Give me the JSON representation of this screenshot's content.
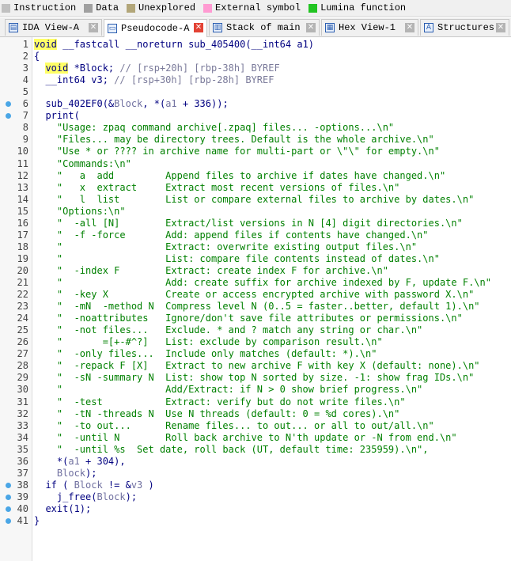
{
  "legend": [
    {
      "label": "Instruction",
      "color": "#c0c0c0"
    },
    {
      "label": "Data",
      "color": "#a0a0a0"
    },
    {
      "label": "Unexplored",
      "color": "#b2a679"
    },
    {
      "label": "External symbol",
      "color": "#ff9bd2"
    },
    {
      "label": "Lumina function",
      "color": "#22c422"
    }
  ],
  "tabs": [
    {
      "label": "IDA View-A",
      "icon": "ida-view-icon"
    },
    {
      "label": "Pseudocode-A",
      "icon": "pseudocode-icon"
    },
    {
      "label": "Stack of main",
      "icon": "stack-icon"
    },
    {
      "label": "Hex View-1",
      "icon": "hex-view-icon"
    },
    {
      "label": "Structures",
      "icon": "structures-icon"
    }
  ],
  "lines": [
    {
      "n": "1",
      "bp": false,
      "segs": [
        [
          "kw",
          "void"
        ],
        [
          "p",
          " __fastcall __noreturn sub_405400(__int64 a1)"
        ]
      ]
    },
    {
      "n": "2",
      "bp": false,
      "segs": [
        [
          "p",
          "{"
        ]
      ]
    },
    {
      "n": "3",
      "bp": false,
      "segs": [
        [
          "p",
          "  "
        ],
        [
          "kw",
          "void"
        ],
        [
          "p",
          " *Block; "
        ],
        [
          "cm",
          "// [rsp+20h] [rbp-38h] BYREF"
        ]
      ]
    },
    {
      "n": "4",
      "bp": false,
      "segs": [
        [
          "p",
          "  __int64 v3; "
        ],
        [
          "cm",
          "// [rsp+30h] [rbp-28h] BYREF"
        ]
      ]
    },
    {
      "n": "5",
      "bp": false,
      "segs": [
        [
          "p",
          ""
        ]
      ]
    },
    {
      "n": "6",
      "bp": true,
      "segs": [
        [
          "p",
          "  sub_402EF0(&"
        ],
        [
          "var",
          "Block"
        ],
        [
          "p",
          ", *("
        ],
        [
          "var",
          "a1"
        ],
        [
          "p",
          " + 336));"
        ]
      ]
    },
    {
      "n": "7",
      "bp": true,
      "segs": [
        [
          "p",
          "  print("
        ]
      ]
    },
    {
      "n": "8",
      "bp": false,
      "segs": [
        [
          "str",
          "    \"Usage: zpaq command archive[.zpaq] files... -options...\\n\""
        ]
      ]
    },
    {
      "n": "9",
      "bp": false,
      "segs": [
        [
          "str",
          "    \"Files... may be directory trees. Default is the whole archive.\\n\""
        ]
      ]
    },
    {
      "n": "10",
      "bp": false,
      "segs": [
        [
          "str",
          "    \"Use * or ???? in archive name for multi-part or \\\"\\\" for empty.\\n\""
        ]
      ]
    },
    {
      "n": "11",
      "bp": false,
      "segs": [
        [
          "str",
          "    \"Commands:\\n\""
        ]
      ]
    },
    {
      "n": "12",
      "bp": false,
      "segs": [
        [
          "str",
          "    \"   a  add         Append files to archive if dates have changed.\\n\""
        ]
      ]
    },
    {
      "n": "13",
      "bp": false,
      "segs": [
        [
          "str",
          "    \"   x  extract     Extract most recent versions of files.\\n\""
        ]
      ]
    },
    {
      "n": "14",
      "bp": false,
      "segs": [
        [
          "str",
          "    \"   l  list        List or compare external files to archive by dates.\\n\""
        ]
      ]
    },
    {
      "n": "15",
      "bp": false,
      "segs": [
        [
          "str",
          "    \"Options:\\n\""
        ]
      ]
    },
    {
      "n": "16",
      "bp": false,
      "segs": [
        [
          "str",
          "    \"  -all [N]        Extract/list versions in N [4] digit directories.\\n\""
        ]
      ]
    },
    {
      "n": "17",
      "bp": false,
      "segs": [
        [
          "str",
          "    \"  -f -force       Add: append files if contents have changed.\\n\""
        ]
      ]
    },
    {
      "n": "18",
      "bp": false,
      "segs": [
        [
          "str",
          "    \"                  Extract: overwrite existing output files.\\n\""
        ]
      ]
    },
    {
      "n": "19",
      "bp": false,
      "segs": [
        [
          "str",
          "    \"                  List: compare file contents instead of dates.\\n\""
        ]
      ]
    },
    {
      "n": "20",
      "bp": false,
      "segs": [
        [
          "str",
          "    \"  -index F        Extract: create index F for archive.\\n\""
        ]
      ]
    },
    {
      "n": "21",
      "bp": false,
      "segs": [
        [
          "str",
          "    \"                  Add: create suffix for archive indexed by F, update F.\\n\""
        ]
      ]
    },
    {
      "n": "22",
      "bp": false,
      "segs": [
        [
          "str",
          "    \"  -key X          Create or access encrypted archive with password X.\\n\""
        ]
      ]
    },
    {
      "n": "23",
      "bp": false,
      "segs": [
        [
          "str",
          "    \"  -mN  -method N  Compress level N (0..5 = faster..better, default 1).\\n\""
        ]
      ]
    },
    {
      "n": "24",
      "bp": false,
      "segs": [
        [
          "str",
          "    \"  -noattributes   Ignore/don't save file attributes or permissions.\\n\""
        ]
      ]
    },
    {
      "n": "25",
      "bp": false,
      "segs": [
        [
          "str",
          "    \"  -not files...   Exclude. * and ? match any string or char.\\n\""
        ]
      ]
    },
    {
      "n": "26",
      "bp": false,
      "segs": [
        [
          "str",
          "    \"       =[+-#^?]   List: exclude by comparison result.\\n\""
        ]
      ]
    },
    {
      "n": "27",
      "bp": false,
      "segs": [
        [
          "str",
          "    \"  -only files...  Include only matches (default: *).\\n\""
        ]
      ]
    },
    {
      "n": "28",
      "bp": false,
      "segs": [
        [
          "str",
          "    \"  -repack F [X]   Extract to new archive F with key X (default: none).\\n\""
        ]
      ]
    },
    {
      "n": "29",
      "bp": false,
      "segs": [
        [
          "str",
          "    \"  -sN -summary N  List: show top N sorted by size. -1: show frag IDs.\\n\""
        ]
      ]
    },
    {
      "n": "30",
      "bp": false,
      "segs": [
        [
          "str",
          "    \"                  Add/Extract: if N > 0 show brief progress.\\n\""
        ]
      ]
    },
    {
      "n": "31",
      "bp": false,
      "segs": [
        [
          "str",
          "    \"  -test           Extract: verify but do not write files.\\n\""
        ]
      ]
    },
    {
      "n": "32",
      "bp": false,
      "segs": [
        [
          "str",
          "    \"  -tN -threads N  Use N threads (default: 0 = %d cores).\\n\""
        ]
      ]
    },
    {
      "n": "33",
      "bp": false,
      "segs": [
        [
          "str",
          "    \"  -to out...      Rename files... to out... or all to out/all.\\n\""
        ]
      ]
    },
    {
      "n": "34",
      "bp": false,
      "segs": [
        [
          "str",
          "    \"  -until N        Roll back archive to N'th update or -N from end.\\n\""
        ]
      ]
    },
    {
      "n": "35",
      "bp": false,
      "segs": [
        [
          "str",
          "    \"  -until %s  Set date, roll back (UT, default time: 235959).\\n\","
        ]
      ]
    },
    {
      "n": "36",
      "bp": false,
      "segs": [
        [
          "p",
          "    *("
        ],
        [
          "var",
          "a1"
        ],
        [
          "p",
          " + 304),"
        ]
      ]
    },
    {
      "n": "37",
      "bp": false,
      "segs": [
        [
          "p",
          "    "
        ],
        [
          "var",
          "Block"
        ],
        [
          "p",
          ");"
        ]
      ]
    },
    {
      "n": "38",
      "bp": true,
      "segs": [
        [
          "p",
          "  if ( "
        ],
        [
          "var",
          "Block"
        ],
        [
          "p",
          " != &"
        ],
        [
          "var",
          "v3"
        ],
        [
          "p",
          " )"
        ]
      ]
    },
    {
      "n": "39",
      "bp": true,
      "segs": [
        [
          "p",
          "    j_free("
        ],
        [
          "var",
          "Block"
        ],
        [
          "p",
          ");"
        ]
      ]
    },
    {
      "n": "40",
      "bp": true,
      "segs": [
        [
          "p",
          "  exit(1);"
        ]
      ]
    },
    {
      "n": "41",
      "bp": true,
      "segs": [
        [
          "p",
          "}"
        ]
      ]
    }
  ]
}
